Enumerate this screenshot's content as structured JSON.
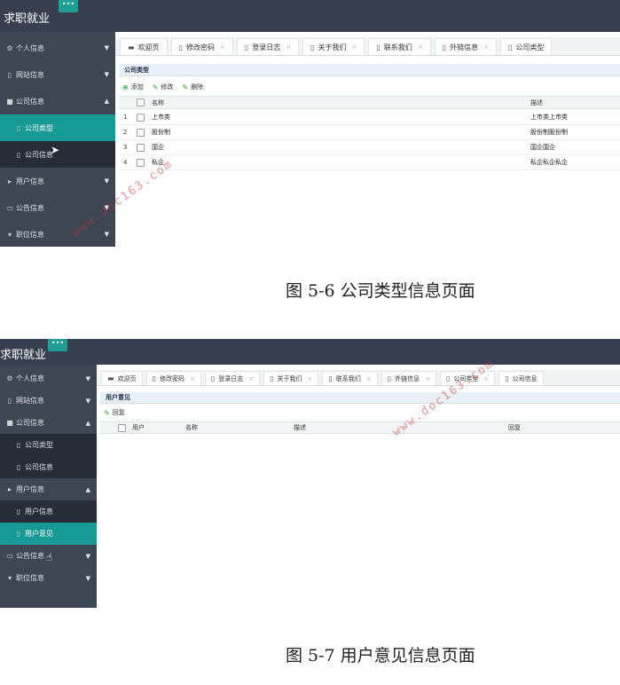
{
  "screenshot1": {
    "app_title": "求职就业",
    "toggle_label": "•••",
    "sidebar": [
      {
        "label": "个人信息",
        "icon": "gear-icon",
        "glyph": "⚙",
        "arrow": "▼"
      },
      {
        "label": "网站信息",
        "icon": "file-icon",
        "glyph": "▯",
        "arrow": "▼"
      },
      {
        "label": "公司信息",
        "icon": "folder-icon",
        "glyph": "■",
        "arrow": "▲"
      },
      {
        "label": "公司类型",
        "icon": "file-icon",
        "glyph": "▯",
        "arrow": "",
        "sub": true,
        "active": true
      },
      {
        "label": "公司信息",
        "icon": "file-icon",
        "glyph": "▯",
        "arrow": "",
        "sub": true
      },
      {
        "label": "用户信息",
        "icon": "caret-right-icon",
        "glyph": "▸",
        "arrow": "▼"
      },
      {
        "label": "公告信息",
        "icon": "comment-icon",
        "glyph": "▭",
        "arrow": "▼"
      },
      {
        "label": "职位信息",
        "icon": "caret-down-icon",
        "glyph": "▾",
        "arrow": "▼"
      }
    ],
    "tabs": [
      {
        "label": "欢迎页",
        "icon": "window-icon",
        "glyph": "▬",
        "closable": false
      },
      {
        "label": "修改密码",
        "icon": "file-icon",
        "glyph": "▯",
        "closable": true
      },
      {
        "label": "登录日志",
        "icon": "file-icon",
        "glyph": "▯",
        "closable": true
      },
      {
        "label": "关于我们",
        "icon": "file-icon",
        "glyph": "▯",
        "closable": true
      },
      {
        "label": "联系我们",
        "icon": "file-icon",
        "glyph": "▯",
        "closable": true
      },
      {
        "label": "外链信息",
        "icon": "file-icon",
        "glyph": "▯",
        "closable": true
      },
      {
        "label": "公司类型",
        "icon": "file-icon",
        "glyph": "▯",
        "closable": false
      }
    ],
    "close_glyph": "×",
    "panel_title": "公司类型",
    "toolbar": {
      "add": "添加",
      "edit": "修改",
      "delete": "删除",
      "add_glyph": "⊕",
      "edit_glyph": "✎"
    },
    "columns": [
      "名称",
      "描述"
    ],
    "rows": [
      {
        "num": "1",
        "name": "上市类",
        "desc": "上市类上市类"
      },
      {
        "num": "2",
        "name": "股份制",
        "desc": "股份制股份制"
      },
      {
        "num": "3",
        "name": "国企",
        "desc": "国企国企"
      },
      {
        "num": "4",
        "name": "私企",
        "desc": "私企私企私企"
      }
    ]
  },
  "caption1": "图 5-6 公司类型信息页面",
  "screenshot2": {
    "app_title": "求职就业",
    "toggle_label": "•••",
    "sidebar": [
      {
        "label": "个人信息",
        "icon": "gear-icon",
        "glyph": "⚙",
        "arrow": "▼"
      },
      {
        "label": "网站信息",
        "icon": "file-icon",
        "glyph": "▯",
        "arrow": "▼"
      },
      {
        "label": "公司信息",
        "icon": "folder-icon",
        "glyph": "■",
        "arrow": "▲"
      },
      {
        "label": "公司类型",
        "icon": "file-icon",
        "glyph": "▯",
        "arrow": "",
        "sub": true
      },
      {
        "label": "公司信息",
        "icon": "file-icon",
        "glyph": "▯",
        "arrow": "",
        "sub": true
      },
      {
        "label": "用户信息",
        "icon": "caret-right-icon",
        "glyph": "▸",
        "arrow": "▲"
      },
      {
        "label": "用户信息",
        "icon": "file-icon",
        "glyph": "▯",
        "arrow": "",
        "sub": true
      },
      {
        "label": "用户意见",
        "icon": "file-icon",
        "glyph": "▯",
        "arrow": "",
        "sub": true,
        "active": true
      },
      {
        "label": "公告信息",
        "icon": "comment-icon",
        "glyph": "▭",
        "arrow": "▼"
      },
      {
        "label": "职位信息",
        "icon": "caret-down-icon",
        "glyph": "▾",
        "arrow": "▼"
      }
    ],
    "tabs": [
      {
        "label": "欢迎页",
        "icon": "window-icon",
        "glyph": "▬",
        "closable": false
      },
      {
        "label": "修改密码",
        "icon": "file-icon",
        "glyph": "▯",
        "closable": true
      },
      {
        "label": "登录日志",
        "icon": "file-icon",
        "glyph": "▯",
        "closable": true
      },
      {
        "label": "关于我们",
        "icon": "file-icon",
        "glyph": "▯",
        "closable": true
      },
      {
        "label": "联系我们",
        "icon": "file-icon",
        "glyph": "▯",
        "closable": true
      },
      {
        "label": "外链信息",
        "icon": "file-icon",
        "glyph": "▯",
        "closable": true
      },
      {
        "label": "公司类型",
        "icon": "file-icon",
        "glyph": "▯",
        "closable": true
      },
      {
        "label": "公司信息",
        "icon": "file-icon",
        "glyph": "▯",
        "closable": false
      }
    ],
    "close_glyph": "×",
    "panel_title": "用户意见",
    "toolbar": {
      "reply": "回复",
      "edit_glyph": "✎"
    },
    "columns": [
      "用户",
      "名称",
      "描述",
      "回复"
    ]
  },
  "caption2": "图 5-7 用户意见信息页面",
  "watermark": "www.doc163.com",
  "colors": {
    "topbar": "#384050",
    "sidebar": "#3d4653",
    "active": "#179a93",
    "submenu": "#262d36"
  }
}
